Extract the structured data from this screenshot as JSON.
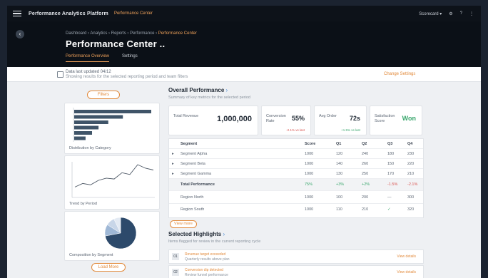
{
  "topbar": {
    "brand": "Performance Analytics Platform",
    "sub": "Performance Center",
    "right_items": [
      "Scorecard ▾",
      "⚙",
      "?",
      "⋮"
    ]
  },
  "header": {
    "breadcrumbs": [
      "Dashboard",
      "Analytics",
      "Reports",
      "Performance"
    ],
    "current_crumb": "Performance Center",
    "title": "Performance Center ..",
    "tabs": [
      {
        "label": "Performance Overview",
        "active": true
      },
      {
        "label": "Settings",
        "active": false
      }
    ]
  },
  "infobar": {
    "line1": "Data last updated 04/12",
    "line2": "Showing results for the selected reporting period and team filters",
    "link": "Change Settings"
  },
  "side": {
    "filter_button": "Filters",
    "bottom_button": "Load More",
    "cards": [
      {
        "caption": "Distribution by Category"
      },
      {
        "caption": "Trend by Period"
      },
      {
        "caption": "Composition by Segment"
      }
    ]
  },
  "overall": {
    "title": "Overall Performance",
    "subtitle": "Summary of key metrics for the selected period"
  },
  "kpis": [
    {
      "label": "Total Revenue",
      "value": "1,000,000",
      "sub": ""
    },
    {
      "label": "Conversion Rate",
      "value": "55%",
      "sub": "-2.1% vs last"
    },
    {
      "label": "Avg Order",
      "value": "72s",
      "sub": "+1.5% vs last"
    },
    {
      "label": "Satisfaction Score",
      "value": "Won",
      "sub": ""
    }
  ],
  "table": {
    "columns": [
      "Segment",
      "Score",
      "Q1",
      "Q2",
      "Q3",
      "Q4"
    ],
    "rows": [
      [
        "Segment Alpha",
        "1000",
        "120",
        "240",
        "180",
        "230"
      ],
      [
        "Segment Beta",
        "1000",
        "140",
        "260",
        "150",
        "220"
      ],
      [
        "Segment Gamma",
        "1000",
        "130",
        "250",
        "170",
        "210"
      ]
    ],
    "summary": [
      "Total Performance",
      "75%",
      "+3%",
      "+2%",
      "-1.5%",
      "-2.1%"
    ],
    "extra_rows": [
      [
        "Region North",
        "1000",
        "100",
        "200",
        "—",
        "300"
      ],
      [
        "Region South",
        "1000",
        "110",
        "210",
        "✓",
        "320"
      ]
    ]
  },
  "more_button": "View more",
  "selected": {
    "title": "Selected Highlights",
    "subtitle": "Items flagged for review in the current reporting cycle",
    "items": [
      {
        "num": "01",
        "title": "Revenue target exceeded",
        "detail": "Quarterly results above plan",
        "action": "View details"
      },
      {
        "num": "02",
        "title": "Conversion dip detected",
        "detail": "Review funnel performance",
        "action": "View details"
      }
    ]
  },
  "chart_bar": {
    "values": [
      95,
      60,
      42,
      30,
      22,
      14
    ]
  },
  "chart_line": {
    "values": [
      20,
      28,
      25,
      35,
      40,
      38,
      52,
      48,
      70,
      62,
      58
    ]
  },
  "chart_pie": {
    "values": [
      72,
      12,
      9,
      7
    ],
    "colors": [
      "#2d4a6b",
      "#9fb8d6",
      "#c8d6e8",
      "#e3eaf3"
    ]
  }
}
